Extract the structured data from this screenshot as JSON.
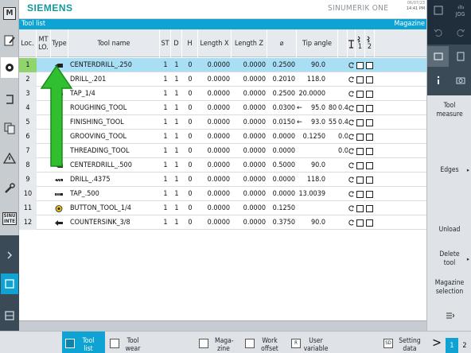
{
  "header": {
    "brand": "SIEMENS",
    "product": "SINUMERIK ONE",
    "date": "06/07/23",
    "time": "14:41 PM"
  },
  "title_bar": {
    "left": "Tool list",
    "right": "Magazine"
  },
  "table": {
    "columns": {
      "loc": "Loc.",
      "mt_lo": "MT LO.",
      "type": "Type",
      "tool_name": "Tool name",
      "st": "ST",
      "d": "D",
      "h": "H",
      "length_x": "Length X",
      "length_z": "Length Z",
      "diameter": "⌀",
      "tip_angle": "Tip angle",
      "col1": "1",
      "col2": "2"
    },
    "rows": [
      {
        "loc": "1",
        "name": "CENTERDRILL_.250",
        "st": "1",
        "d": "1",
        "h": "0",
        "lx": "0.0000",
        "lz": "0.0000",
        "dia": "0.2500",
        "arrow": "",
        "tip": "90.0",
        "tip2": "",
        "tip3": "",
        "icon": "centerdrill-icon",
        "selected": true
      },
      {
        "loc": "2",
        "name": "DRILL_.201",
        "st": "1",
        "d": "1",
        "h": "0",
        "lx": "0.0000",
        "lz": "0.0000",
        "dia": "0.2010",
        "arrow": "",
        "tip": "118.0",
        "tip2": "",
        "tip3": "",
        "icon": "drill-icon"
      },
      {
        "loc": "3",
        "name": "TAP_1/4",
        "st": "1",
        "d": "1",
        "h": "0",
        "lx": "0.0000",
        "lz": "0.0000",
        "dia": "0.2500",
        "arrow": "",
        "tip": "20.0000",
        "tip2": "",
        "tip3": "",
        "icon": "tap-icon"
      },
      {
        "loc": "4",
        "name": "ROUGHING_TOOL",
        "st": "1",
        "d": "1",
        "h": "0",
        "lx": "0.0000",
        "lz": "0.0000",
        "dia": "0.0300",
        "arrow": "←",
        "tip": "95.0",
        "tip2": "80",
        "tip3": "0.4",
        "icon": "roughing-tool-icon"
      },
      {
        "loc": "5",
        "name": "FINISHING_TOOL",
        "st": "1",
        "d": "1",
        "h": "0",
        "lx": "0.0000",
        "lz": "0.0000",
        "dia": "0.0150",
        "arrow": "←",
        "tip": "93.0",
        "tip2": "55",
        "tip3": "0.4",
        "icon": "finishing-tool-icon"
      },
      {
        "loc": "6",
        "name": "GROOVING_TOOL",
        "st": "1",
        "d": "1",
        "h": "0",
        "lx": "0.0000",
        "lz": "0.0000",
        "dia": "0.0000",
        "arrow": "",
        "tip": "0.1250",
        "tip2": "",
        "tip3": "0.0",
        "icon": "grooving-tool-icon"
      },
      {
        "loc": "7",
        "name": "THREADING_TOOL",
        "st": "1",
        "d": "1",
        "h": "0",
        "lx": "0.0000",
        "lz": "0.0000",
        "dia": "0.0000",
        "arrow": "",
        "tip": "",
        "tip2": "",
        "tip3": "0.0",
        "icon": "threading-tool-icon"
      },
      {
        "loc": "8",
        "name": "CENTERDRILL_.500",
        "st": "1",
        "d": "1",
        "h": "0",
        "lx": "0.0000",
        "lz": "0.0000",
        "dia": "0.5000",
        "arrow": "",
        "tip": "90.0",
        "tip2": "",
        "tip3": "",
        "icon": "centerdrill-icon"
      },
      {
        "loc": "9",
        "name": "DRILL_.4375",
        "st": "1",
        "d": "1",
        "h": "0",
        "lx": "0.0000",
        "lz": "0.0000",
        "dia": "0.0000",
        "arrow": "",
        "tip": "118.0",
        "tip2": "",
        "tip3": "",
        "icon": "drill-icon"
      },
      {
        "loc": "10",
        "name": "TAP_.500",
        "st": "1",
        "d": "1",
        "h": "0",
        "lx": "0.0000",
        "lz": "0.0000",
        "dia": "0.0000",
        "arrow": "",
        "tip": "13.0039",
        "tip2": "",
        "tip3": "",
        "icon": "tap-icon"
      },
      {
        "loc": "11",
        "name": "BUTTON_TOOL_1/4",
        "st": "1",
        "d": "1",
        "h": "0",
        "lx": "0.0000",
        "lz": "0.0000",
        "dia": "0.1250",
        "arrow": "",
        "tip": "",
        "tip2": "",
        "tip3": "",
        "icon": "button-tool-icon"
      },
      {
        "loc": "12",
        "name": "COUNTERSINK_3/8",
        "st": "1",
        "d": "1",
        "h": "0",
        "lx": "0.0000",
        "lz": "0.0000",
        "dia": "0.3750",
        "arrow": "",
        "tip": "90.0",
        "tip2": "",
        "tip3": "",
        "icon": "countersink-icon"
      }
    ]
  },
  "right_softkeys": {
    "tool_measure": "Tool measure",
    "edges": "Edges",
    "unload": "Unload",
    "delete_tool": "Delete tool",
    "magazine_selection": "Magazine selection",
    "jog_label": "JOG"
  },
  "bottom_softkeys": {
    "tool_list": "Tool list",
    "tool_wear": "Tool wear",
    "magazine": "Maga-zine",
    "work_offset": "Work offset",
    "user_variable": "User variable",
    "setting_data": "Setting data",
    "page1": "1",
    "page2": "2",
    "next": ">"
  },
  "left_rail": {
    "m_label": "M",
    "sinu_label": "SINU INTE"
  },
  "colors": {
    "accent": "#0fa3d4",
    "selected_row": "#a9dff5",
    "selected_loc": "#8fd46d",
    "brand": "#119a9a",
    "annotation_arrow": "#2fbf2f"
  }
}
